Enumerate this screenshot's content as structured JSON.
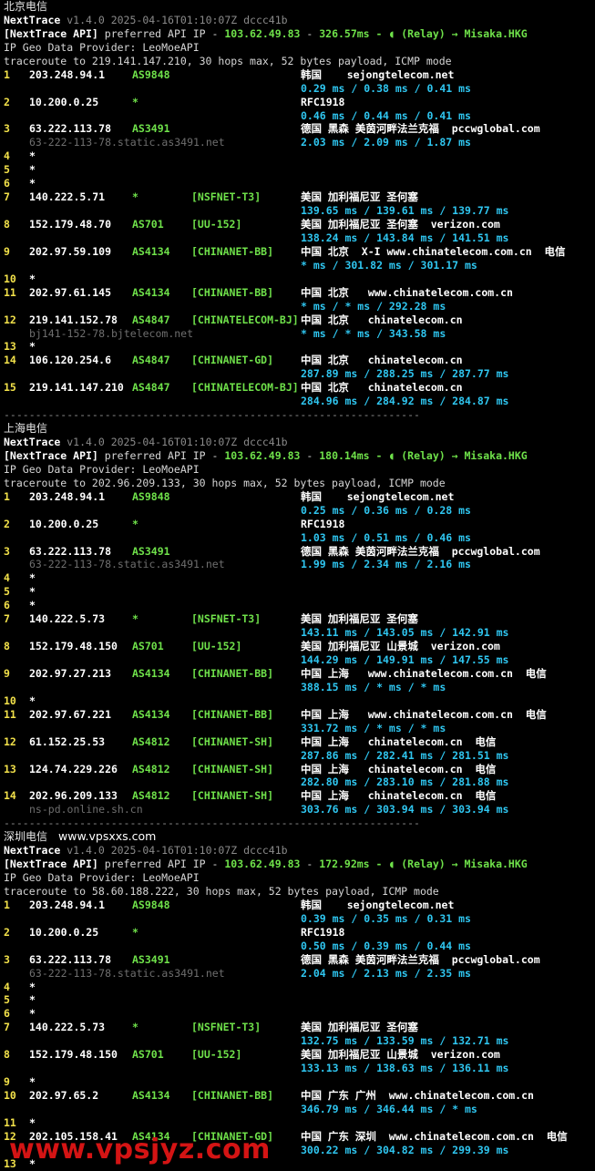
{
  "sections": [
    {
      "title": "北京电信",
      "site": "",
      "app_name": "NextTrace",
      "version_line": "v1.4.0 2025-04-16T01:10:07Z dccc41b",
      "api_tag": "[NextTrace API]",
      "api_text": " preferred API IP - ",
      "api_ip": "103.62.49.83",
      "api_sep": " - ",
      "api_latency": "326.57ms",
      "api_relay": " - ◖ (Relay) → Misaka.HKG",
      "geo_provider": "IP Geo Data Provider: LeoMoeAPI",
      "traceroute_line": "traceroute to 219.141.147.210, 30 hops max, 52 bytes payload, ICMP mode",
      "hops": [
        {
          "n": "1",
          "ip": "203.248.94.1",
          "asn": "AS9848",
          "tag": "",
          "geo": "韩国    sejongtelecom.net",
          "host": "",
          "rtt": "0.29 ms / 0.38 ms / 0.41 ms"
        },
        {
          "n": "2",
          "ip": "10.200.0.25",
          "asn": "*",
          "tag": "",
          "geo": "RFC1918",
          "host": "",
          "rtt": "0.46 ms / 0.44 ms / 0.41 ms"
        },
        {
          "n": "3",
          "ip": "63.222.113.78",
          "asn": "AS3491",
          "tag": "",
          "geo": "德国 黑森 美茵河畔法兰克福  pccwglobal.com",
          "host": "63-222-113-78.static.as3491.net",
          "rtt": "2.03 ms / 2.09 ms / 1.87 ms"
        },
        {
          "n": "4",
          "star": "*"
        },
        {
          "n": "5",
          "star": "*"
        },
        {
          "n": "6",
          "star": "*"
        },
        {
          "n": "7",
          "ip": "140.222.5.71",
          "asn": "*",
          "tag": "[NSFNET-T3]",
          "geo": "美国 加利福尼亚 圣何塞",
          "host": "",
          "rtt": "139.65 ms / 139.61 ms / 139.77 ms"
        },
        {
          "n": "8",
          "ip": "152.179.48.70",
          "asn": "AS701",
          "tag": "[UU-152]",
          "geo": "美国 加利福尼亚 圣何塞  verizon.com",
          "host": "",
          "rtt": "138.24 ms / 143.84 ms / 141.51 ms"
        },
        {
          "n": "9",
          "ip": "202.97.59.109",
          "asn": "AS4134",
          "tag": "[CHINANET-BB]",
          "geo": "中国 北京  X-I www.chinatelecom.com.cn  电信",
          "host": "",
          "rtt": "* ms / 301.82 ms / 301.17 ms"
        },
        {
          "n": "10",
          "star": "*"
        },
        {
          "n": "11",
          "ip": "202.97.61.145",
          "asn": "AS4134",
          "tag": "[CHINANET-BB]",
          "geo": "中国 北京   www.chinatelecom.com.cn",
          "host": "",
          "rtt": "* ms / * ms / 292.28 ms"
        },
        {
          "n": "12",
          "ip": "219.141.152.78",
          "asn": "AS4847",
          "tag": "[CHINATELECOM-BJ]",
          "geo": "中国 北京   chinatelecom.cn",
          "host": "bj141-152-78.bjtelecom.net",
          "rtt": "* ms / * ms / 343.58 ms"
        },
        {
          "n": "13",
          "star": "*"
        },
        {
          "n": "14",
          "ip": "106.120.254.6",
          "asn": "AS4847",
          "tag": "[CHINANET-GD]",
          "geo": "中国 北京   chinatelecom.cn",
          "host": "",
          "rtt": "287.89 ms / 288.25 ms / 287.77 ms"
        },
        {
          "n": "15",
          "ip": "219.141.147.210",
          "asn": "AS4847",
          "tag": "[CHINATELECOM-BJ]",
          "geo": "中国 北京   chinatelecom.cn",
          "host": "",
          "rtt": "284.96 ms / 284.92 ms / 284.87 ms"
        }
      ]
    },
    {
      "title": "上海电信",
      "site": "",
      "app_name": "NextTrace",
      "version_line": "v1.4.0 2025-04-16T01:10:07Z dccc41b",
      "api_tag": "[NextTrace API]",
      "api_text": " preferred API IP - ",
      "api_ip": "103.62.49.83",
      "api_sep": " - ",
      "api_latency": "180.14ms",
      "api_relay": " - ◖ (Relay) → Misaka.HKG",
      "geo_provider": "IP Geo Data Provider: LeoMoeAPI",
      "traceroute_line": "traceroute to 202.96.209.133, 30 hops max, 52 bytes payload, ICMP mode",
      "hops": [
        {
          "n": "1",
          "ip": "203.248.94.1",
          "asn": "AS9848",
          "tag": "",
          "geo": "韩国    sejongtelecom.net",
          "host": "",
          "rtt": "0.25 ms / 0.36 ms / 0.28 ms"
        },
        {
          "n": "2",
          "ip": "10.200.0.25",
          "asn": "*",
          "tag": "",
          "geo": "RFC1918",
          "host": "",
          "rtt": "1.03 ms / 0.51 ms / 0.46 ms"
        },
        {
          "n": "3",
          "ip": "63.222.113.78",
          "asn": "AS3491",
          "tag": "",
          "geo": "德国 黑森 美茵河畔法兰克福  pccwglobal.com",
          "host": "63-222-113-78.static.as3491.net",
          "rtt": "1.99 ms / 2.34 ms / 2.16 ms"
        },
        {
          "n": "4",
          "star": "*"
        },
        {
          "n": "5",
          "star": "*"
        },
        {
          "n": "6",
          "star": "*"
        },
        {
          "n": "7",
          "ip": "140.222.5.73",
          "asn": "*",
          "tag": "[NSFNET-T3]",
          "geo": "美国 加利福尼亚 圣何塞",
          "host": "",
          "rtt": "143.11 ms / 143.05 ms / 142.91 ms"
        },
        {
          "n": "8",
          "ip": "152.179.48.150",
          "asn": "AS701",
          "tag": "[UU-152]",
          "geo": "美国 加利福尼亚 山景城  verizon.com",
          "host": "",
          "rtt": "144.29 ms / 149.91 ms / 147.55 ms"
        },
        {
          "n": "9",
          "ip": "202.97.27.213",
          "asn": "AS4134",
          "tag": "[CHINANET-BB]",
          "geo": "中国 上海   www.chinatelecom.com.cn  电信",
          "host": "",
          "rtt": "388.15 ms / * ms / * ms"
        },
        {
          "n": "10",
          "star": "*"
        },
        {
          "n": "11",
          "ip": "202.97.67.221",
          "asn": "AS4134",
          "tag": "[CHINANET-BB]",
          "geo": "中国 上海   www.chinatelecom.com.cn  电信",
          "host": "",
          "rtt": "331.72 ms / * ms / * ms"
        },
        {
          "n": "12",
          "ip": "61.152.25.53",
          "asn": "AS4812",
          "tag": "[CHINANET-SH]",
          "geo": "中国 上海   chinatelecom.cn  电信",
          "host": "",
          "rtt": "287.86 ms / 282.41 ms / 281.51 ms"
        },
        {
          "n": "13",
          "ip": "124.74.229.226",
          "asn": "AS4812",
          "tag": "[CHINANET-SH]",
          "geo": "中国 上海   chinatelecom.cn  电信",
          "host": "",
          "rtt": "282.80 ms / 283.10 ms / 281.88 ms"
        },
        {
          "n": "14",
          "ip": "202.96.209.133",
          "asn": "AS4812",
          "tag": "[CHINANET-SH]",
          "geo": "中国 上海   chinatelecom.cn  电信",
          "host": "ns-pd.online.sh.cn",
          "rtt": "303.76 ms / 303.94 ms / 303.94 ms"
        }
      ]
    },
    {
      "title": "深圳电信",
      "site": "www.vpsxxs.com",
      "app_name": "NextTrace",
      "version_line": "v1.4.0 2025-04-16T01:10:07Z dccc41b",
      "api_tag": "[NextTrace API]",
      "api_text": " preferred API IP - ",
      "api_ip": "103.62.49.83",
      "api_sep": " - ",
      "api_latency": "172.92ms",
      "api_relay": " - ◖ (Relay) → Misaka.HKG",
      "geo_provider": "IP Geo Data Provider: LeoMoeAPI",
      "traceroute_line": "traceroute to 58.60.188.222, 30 hops max, 52 bytes payload, ICMP mode",
      "hops": [
        {
          "n": "1",
          "ip": "203.248.94.1",
          "asn": "AS9848",
          "tag": "",
          "geo": "韩国    sejongtelecom.net",
          "host": "",
          "rtt": "0.39 ms / 0.35 ms / 0.31 ms"
        },
        {
          "n": "2",
          "ip": "10.200.0.25",
          "asn": "*",
          "tag": "",
          "geo": "RFC1918",
          "host": "",
          "rtt": "0.50 ms / 0.39 ms / 0.44 ms"
        },
        {
          "n": "3",
          "ip": "63.222.113.78",
          "asn": "AS3491",
          "tag": "",
          "geo": "德国 黑森 美茵河畔法兰克福  pccwglobal.com",
          "host": "63-222-113-78.static.as3491.net",
          "rtt": "2.04 ms / 2.13 ms / 2.35 ms"
        },
        {
          "n": "4",
          "star": "*"
        },
        {
          "n": "5",
          "star": "*"
        },
        {
          "n": "6",
          "star": "*"
        },
        {
          "n": "7",
          "ip": "140.222.5.73",
          "asn": "*",
          "tag": "[NSFNET-T3]",
          "geo": "美国 加利福尼亚 圣何塞",
          "host": "",
          "rtt": "132.75 ms / 133.59 ms / 132.71 ms"
        },
        {
          "n": "8",
          "ip": "152.179.48.150",
          "asn": "AS701",
          "tag": "[UU-152]",
          "geo": "美国 加利福尼亚 山景城  verizon.com",
          "host": "",
          "rtt": "133.13 ms / 138.63 ms / 136.11 ms"
        },
        {
          "n": "9",
          "star": "*"
        },
        {
          "n": "10",
          "ip": "202.97.65.2",
          "asn": "AS4134",
          "tag": "[CHINANET-BB]",
          "geo": "中国 广东 广州  www.chinatelecom.com.cn",
          "host": "",
          "rtt": "346.79 ms / 346.44 ms / * ms"
        },
        {
          "n": "11",
          "star": "*"
        },
        {
          "n": "12",
          "ip": "202.105.158.41",
          "asn": "AS4134",
          "tag": "[CHINANET-GD]",
          "geo": "中国 广东 深圳  www.chinatelecom.com.cn  电信",
          "host": "",
          "rtt": "300.22 ms / 304.82 ms / 299.39 ms"
        },
        {
          "n": "13",
          "star": "*"
        }
      ]
    }
  ],
  "separator": "------------------------------------------------------------------",
  "watermark": "www.vpsjyz.com"
}
